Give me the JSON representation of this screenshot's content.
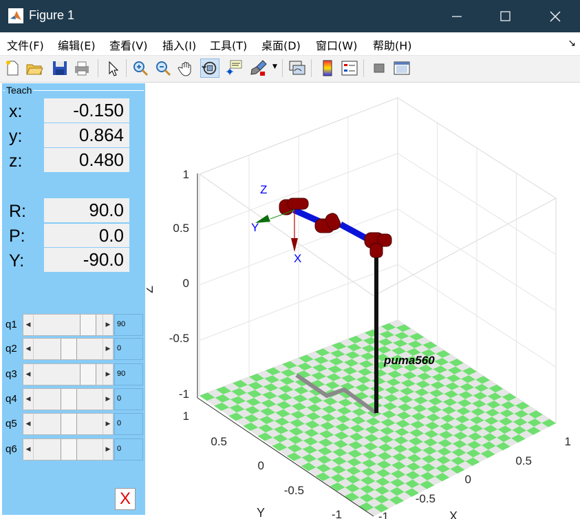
{
  "window": {
    "title": "Figure 1"
  },
  "menu": [
    "文件(F)",
    "编辑(E)",
    "查看(V)",
    "插入(I)",
    "工具(T)",
    "桌面(D)",
    "窗口(W)",
    "帮助(H)"
  ],
  "toolbar": {
    "buttons": [
      "new-figure",
      "open-file",
      "save",
      "print",
      "pointer",
      "zoom-in",
      "zoom-out",
      "pan",
      "rotate-3d",
      "data-cursor",
      "brush",
      "link-plot",
      "colorbar",
      "legend",
      "hide-plot-tools",
      "show-plot-tools"
    ],
    "active": "rotate-3d"
  },
  "teach": {
    "title": "Teach",
    "pose": [
      {
        "label": "x:",
        "value": "-0.150"
      },
      {
        "label": "y:",
        "value": "0.864"
      },
      {
        "label": "z:",
        "value": "0.480"
      },
      {
        "label": "R:",
        "value": "90.0"
      },
      {
        "label": "P:",
        "value": "0.0"
      },
      {
        "label": "Y:",
        "value": "-90.0"
      }
    ],
    "joints": [
      {
        "label": "q1",
        "value": "90",
        "level": 0.85
      },
      {
        "label": "q2",
        "value": "0",
        "level": 0.5
      },
      {
        "label": "q3",
        "value": "90",
        "level": 0.85
      },
      {
        "label": "q4",
        "value": "0",
        "level": 0.5
      },
      {
        "label": "q5",
        "value": "0",
        "level": 0.5
      },
      {
        "label": "q6",
        "value": "0",
        "level": 0.5
      }
    ],
    "close_label": "X"
  },
  "plot": {
    "robot_name": "puma560",
    "zlabel": "Z",
    "ylabel": "Y",
    "xlabel": "X",
    "z_ticks": [
      "1",
      "0.5",
      "0",
      "-0.5",
      "-1"
    ],
    "y_ticks": [
      "1",
      "0.5",
      "0",
      "-0.5",
      "-1"
    ],
    "x_ticks": [
      "1",
      "0.5",
      "0",
      "-0.5",
      "-1"
    ],
    "frame_labels": {
      "z": "Z",
      "y": "Y",
      "x": "X"
    },
    "colors": {
      "panel": "#87ccf7",
      "floor_green": "#6fe06f",
      "floor_light": "#e6e6e6",
      "link": "#8b0000",
      "axis_blue": "#0000ff"
    }
  }
}
